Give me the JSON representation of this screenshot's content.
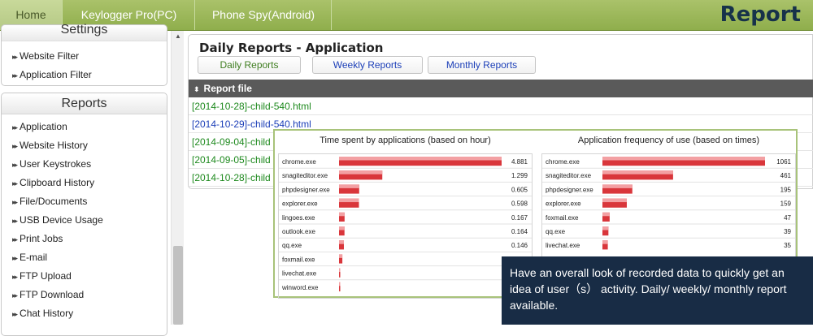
{
  "nav": {
    "tabs": [
      {
        "label": "Home"
      },
      {
        "label": "Keylogger Pro(PC)"
      },
      {
        "label": "Phone Spy(Android)"
      }
    ],
    "page_title": "Report"
  },
  "sidebar": {
    "settings": {
      "header": "Settings",
      "items": [
        {
          "label": "Website Filter"
        },
        {
          "label": "Application Filter"
        }
      ]
    },
    "reports": {
      "header": "Reports",
      "items": [
        {
          "label": "Application"
        },
        {
          "label": "Website History"
        },
        {
          "label": "User Keystrokes"
        },
        {
          "label": "Clipboard History"
        },
        {
          "label": "File/Documents"
        },
        {
          "label": "USB Device Usage"
        },
        {
          "label": "Print Jobs"
        },
        {
          "label": "E-mail"
        },
        {
          "label": "FTP Upload"
        },
        {
          "label": "FTP Download"
        },
        {
          "label": "Chat History"
        }
      ]
    },
    "arrow_glyph": "▸▸"
  },
  "main": {
    "title": "Daily Reports - Application",
    "buttons": {
      "daily": "Daily Reports",
      "weekly": "Weekly Reports",
      "monthly": "Monthly Reports"
    },
    "table_header": "Report file",
    "sort_glyph": "⬍",
    "rows": [
      {
        "label": "[2014-10-28]-child-540.html"
      },
      {
        "label": "[2014-10-29]-child-540.html"
      },
      {
        "label": "[2014-09-04]-child"
      },
      {
        "label": "[2014-09-05]-child"
      },
      {
        "label": "[2014-10-28]-child"
      }
    ]
  },
  "chart_data": [
    {
      "type": "bar",
      "title": "Time spent by applications (based on hour)",
      "categories": [
        "chrome.exe",
        "snagiteditor.exe",
        "phpdesigner.exe",
        "explorer.exe",
        "lingoes.exe",
        "outlook.exe",
        "qq.exe",
        "foxmail.exe",
        "livechat.exe",
        "winword.exe"
      ],
      "values": [
        4.881,
        1.299,
        0.605,
        0.598,
        0.167,
        0.164,
        0.146,
        null,
        null,
        null
      ],
      "value_labels": [
        "4.881",
        "1.299",
        "0.605",
        "0.598",
        "0.167",
        "0.164",
        "0.146",
        "",
        "",
        ""
      ],
      "bar_values_estimated": [
        4.881,
        1.299,
        0.605,
        0.598,
        0.167,
        0.164,
        0.146,
        0.1,
        0.03,
        0.02
      ],
      "bar_color": "#d9363b",
      "xlim": [
        0,
        4.881
      ]
    },
    {
      "type": "bar",
      "title": "Application frequency of use (based on times)",
      "categories": [
        "chrome.exe",
        "snagiteditor.exe",
        "phpdesigner.exe",
        "explorer.exe",
        "foxmail.exe",
        "qq.exe",
        "livechat.exe"
      ],
      "values": [
        1061,
        461,
        195,
        159,
        47,
        39,
        35
      ],
      "value_labels": [
        "1061",
        "461",
        "195",
        "159",
        "47",
        "39",
        "35"
      ],
      "bar_color": "#d9363b",
      "xlim": [
        0,
        1061
      ]
    }
  ],
  "callout": {
    "text": "Have an overall look of recorded data to quickly get an idea of user（s） activity. Daily/ weekly/ monthly report available."
  }
}
